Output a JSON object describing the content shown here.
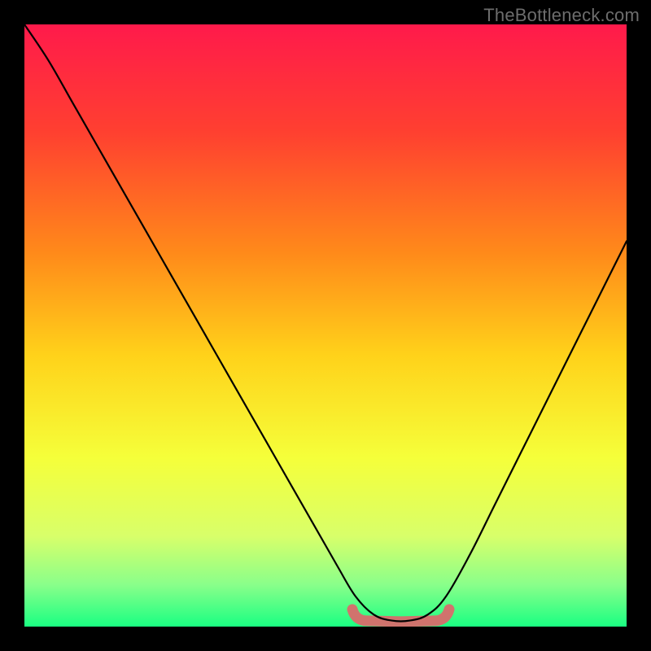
{
  "watermark": "TheBottleneck.com",
  "chart_data": {
    "type": "line",
    "title": "",
    "xlabel": "",
    "ylabel": "",
    "xlim": [
      0,
      100
    ],
    "ylim": [
      0,
      100
    ],
    "x": [
      0,
      4,
      8,
      12,
      16,
      20,
      24,
      28,
      32,
      36,
      40,
      44,
      48,
      52,
      55,
      58,
      61,
      64,
      67,
      70,
      74,
      78,
      82,
      86,
      90,
      94,
      98,
      100
    ],
    "values": [
      100,
      94,
      87,
      80,
      73,
      66,
      59,
      52,
      45,
      38,
      31,
      24,
      17,
      10,
      5,
      2,
      1,
      1,
      2,
      5,
      12,
      20,
      28,
      36,
      44,
      52,
      60,
      64
    ],
    "highlight_band": {
      "x_start": 55,
      "x_end": 70,
      "y": 1.5
    },
    "background": "rainbow_vertical_gradient",
    "gradient_stops": [
      {
        "pos": 0.0,
        "color": "#ff1a4b"
      },
      {
        "pos": 0.18,
        "color": "#ff4030"
      },
      {
        "pos": 0.38,
        "color": "#ff8a1a"
      },
      {
        "pos": 0.55,
        "color": "#ffd21a"
      },
      {
        "pos": 0.72,
        "color": "#f5ff3a"
      },
      {
        "pos": 0.85,
        "color": "#d8ff6a"
      },
      {
        "pos": 0.93,
        "color": "#8aff8a"
      },
      {
        "pos": 1.0,
        "color": "#1aff82"
      }
    ],
    "curve_color": "#000000",
    "highlight_color": "#d96b6b"
  }
}
